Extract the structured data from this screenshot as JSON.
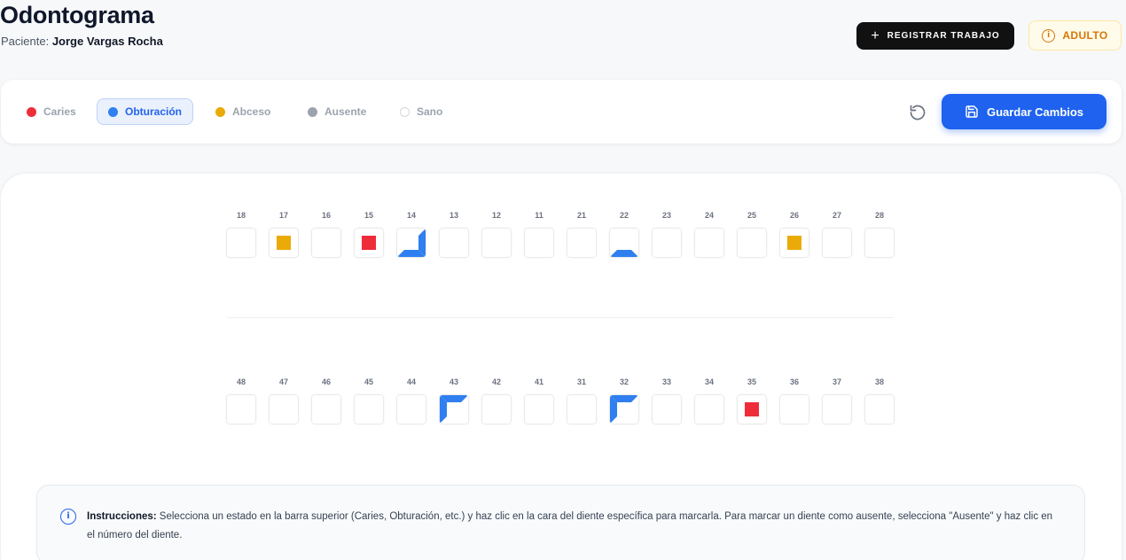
{
  "header": {
    "title": "Odontograma",
    "patient_label": "Paciente:",
    "patient_name": "Jorge Vargas Rocha",
    "register_button": "REGISTRAR TRABAJO",
    "age_badge": "ADULTO"
  },
  "toolbar": {
    "statuses": [
      {
        "label": "Caries",
        "color": "#ef2d3a",
        "active": false
      },
      {
        "label": "Obturación",
        "color": "#2f7ff0",
        "active": true
      },
      {
        "label": "Abceso",
        "color": "#eaaa08",
        "active": false
      },
      {
        "label": "Ausente",
        "color": "#9ca3af",
        "active": false
      },
      {
        "label": "Sano",
        "color": "#ffffff",
        "active": false
      }
    ],
    "save_button": "Guardar Cambios"
  },
  "colors": {
    "caries": "#ef2d3a",
    "obturacion": "#2f7ff0",
    "abceso": "#eaaa08",
    "ausente": "#9ca3af",
    "primary": "#1e62ef"
  },
  "odontogram": {
    "upper": [
      {
        "number": "18",
        "state": "sano"
      },
      {
        "number": "17",
        "state": "abceso"
      },
      {
        "number": "16",
        "state": "sano"
      },
      {
        "number": "15",
        "state": "caries"
      },
      {
        "number": "14",
        "state": "obturacion",
        "faces": [
          "right",
          "bottom"
        ]
      },
      {
        "number": "13",
        "state": "sano"
      },
      {
        "number": "12",
        "state": "sano"
      },
      {
        "number": "11",
        "state": "sano"
      },
      {
        "number": "21",
        "state": "sano"
      },
      {
        "number": "22",
        "state": "obturacion",
        "faces": [
          "bottom"
        ]
      },
      {
        "number": "23",
        "state": "sano"
      },
      {
        "number": "24",
        "state": "sano"
      },
      {
        "number": "25",
        "state": "sano"
      },
      {
        "number": "26",
        "state": "abceso"
      },
      {
        "number": "27",
        "state": "sano"
      },
      {
        "number": "28",
        "state": "sano"
      }
    ],
    "lower": [
      {
        "number": "48",
        "state": "sano"
      },
      {
        "number": "47",
        "state": "sano"
      },
      {
        "number": "46",
        "state": "sano"
      },
      {
        "number": "45",
        "state": "sano"
      },
      {
        "number": "44",
        "state": "sano"
      },
      {
        "number": "43",
        "state": "obturacion",
        "faces": [
          "top",
          "left"
        ]
      },
      {
        "number": "42",
        "state": "sano"
      },
      {
        "number": "41",
        "state": "sano"
      },
      {
        "number": "31",
        "state": "sano"
      },
      {
        "number": "32",
        "state": "obturacion",
        "faces": [
          "top",
          "left"
        ]
      },
      {
        "number": "33",
        "state": "sano"
      },
      {
        "number": "34",
        "state": "sano"
      },
      {
        "number": "35",
        "state": "caries"
      },
      {
        "number": "36",
        "state": "sano"
      },
      {
        "number": "37",
        "state": "sano"
      },
      {
        "number": "38",
        "state": "sano"
      }
    ]
  },
  "instructions": {
    "label": "Instrucciones:",
    "text": " Selecciona un estado en la barra superior (Caries, Obturación, etc.) y haz clic en la cara del diente específica para marcarla. Para marcar un diente como ausente, selecciona \"Ausente\" y haz clic en el número del diente."
  }
}
